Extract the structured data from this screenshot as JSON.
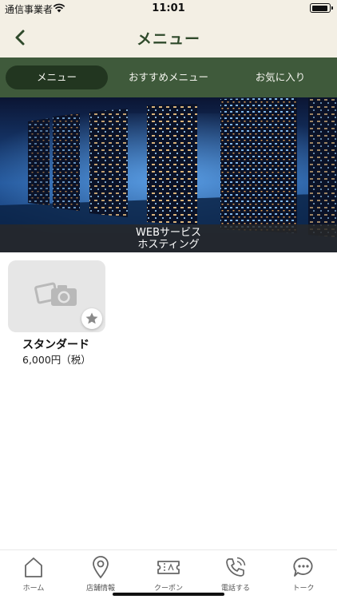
{
  "status_bar": {
    "carrier": "通信事業者",
    "time": "11:01"
  },
  "header": {
    "title": "メニュー"
  },
  "tabs": [
    {
      "label": "メニュー",
      "active": true
    },
    {
      "label": "おすすめメニュー",
      "active": false
    },
    {
      "label": "お気に入り",
      "active": false
    }
  ],
  "banner": {
    "caption_line1": "WEBサービス",
    "caption_line2": "ホスティング"
  },
  "products": [
    {
      "name": "スタンダード",
      "price": "6,000円（税）",
      "image": "camera-placeholder-icon",
      "favorite_icon": "star-icon"
    }
  ],
  "bottom_nav": [
    {
      "label": "ホーム",
      "icon": "home-icon"
    },
    {
      "label": "店舗情報",
      "icon": "map-pin-icon"
    },
    {
      "label": "クーポン",
      "icon": "ticket-icon"
    },
    {
      "label": "電話する",
      "icon": "phone-icon"
    },
    {
      "label": "トーク",
      "icon": "chat-icon"
    }
  ],
  "colors": {
    "header_bg": "#f3efe4",
    "tab_bar_bg": "#3f5a3b",
    "active_tab_bg": "#223620",
    "title_color": "#2f4a2b"
  }
}
